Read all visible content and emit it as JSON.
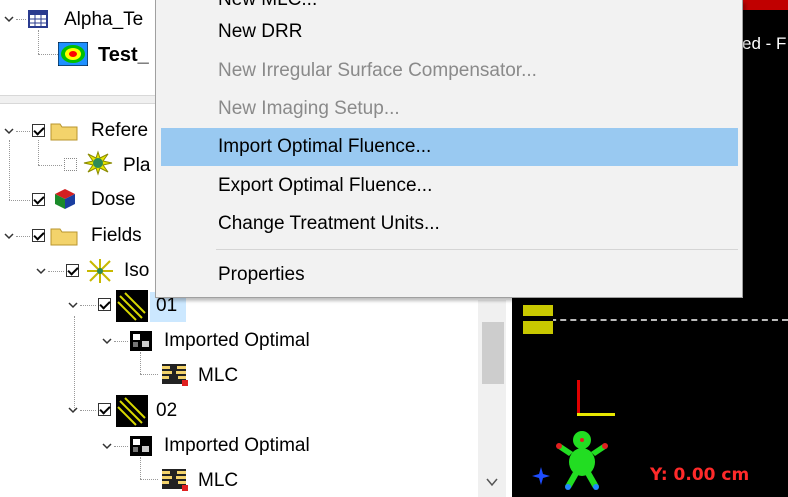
{
  "top_tree": {
    "plan_label": "Alpha_Te",
    "course_label": "Test_"
  },
  "bottom_tree": {
    "reference_label": "Refere",
    "plan_item_label": "Pla",
    "dose_label": "Dose",
    "fields_label": "Fields",
    "iso_label": "Iso",
    "field1_label": "01",
    "field1_fluence_label": "Imported Optimal",
    "field1_mlc_label": "MLC",
    "field2_label": "02",
    "field2_fluence_label": "Imported Optimal",
    "field2_mlc_label": "MLC"
  },
  "context_menu": {
    "items": [
      {
        "label": "New MLC...",
        "state": "partially-visible"
      },
      {
        "label": "New DRR",
        "state": "enabled"
      },
      {
        "label": "New Irregular Surface Compensator...",
        "state": "disabled"
      },
      {
        "label": "New Imaging Setup...",
        "state": "disabled"
      },
      {
        "label": "Import Optimal Fluence...",
        "state": "highlighted"
      },
      {
        "label": "Export Optimal Fluence...",
        "state": "enabled"
      },
      {
        "label": "Change Treatment Units...",
        "state": "enabled"
      },
      {
        "label": "Properties",
        "state": "enabled"
      }
    ]
  },
  "viewer": {
    "title_fragment": "ed - F",
    "y_readout": "Y: 0.00 cm"
  },
  "colors": {
    "menu_highlight": "#99c9f1",
    "viewer_bg": "#000000",
    "readout_red": "#ff2a2a",
    "field_selected": "#cce8ff"
  },
  "icons": [
    "table-icon",
    "dose-course-icon",
    "folder-icon",
    "plan-icon",
    "cube-icon",
    "isocenter-icon",
    "field-beam-icon",
    "fluence-icon",
    "mlc-icon",
    "chevron-down-icon",
    "human-figure-icon",
    "compass-star-icon"
  ]
}
